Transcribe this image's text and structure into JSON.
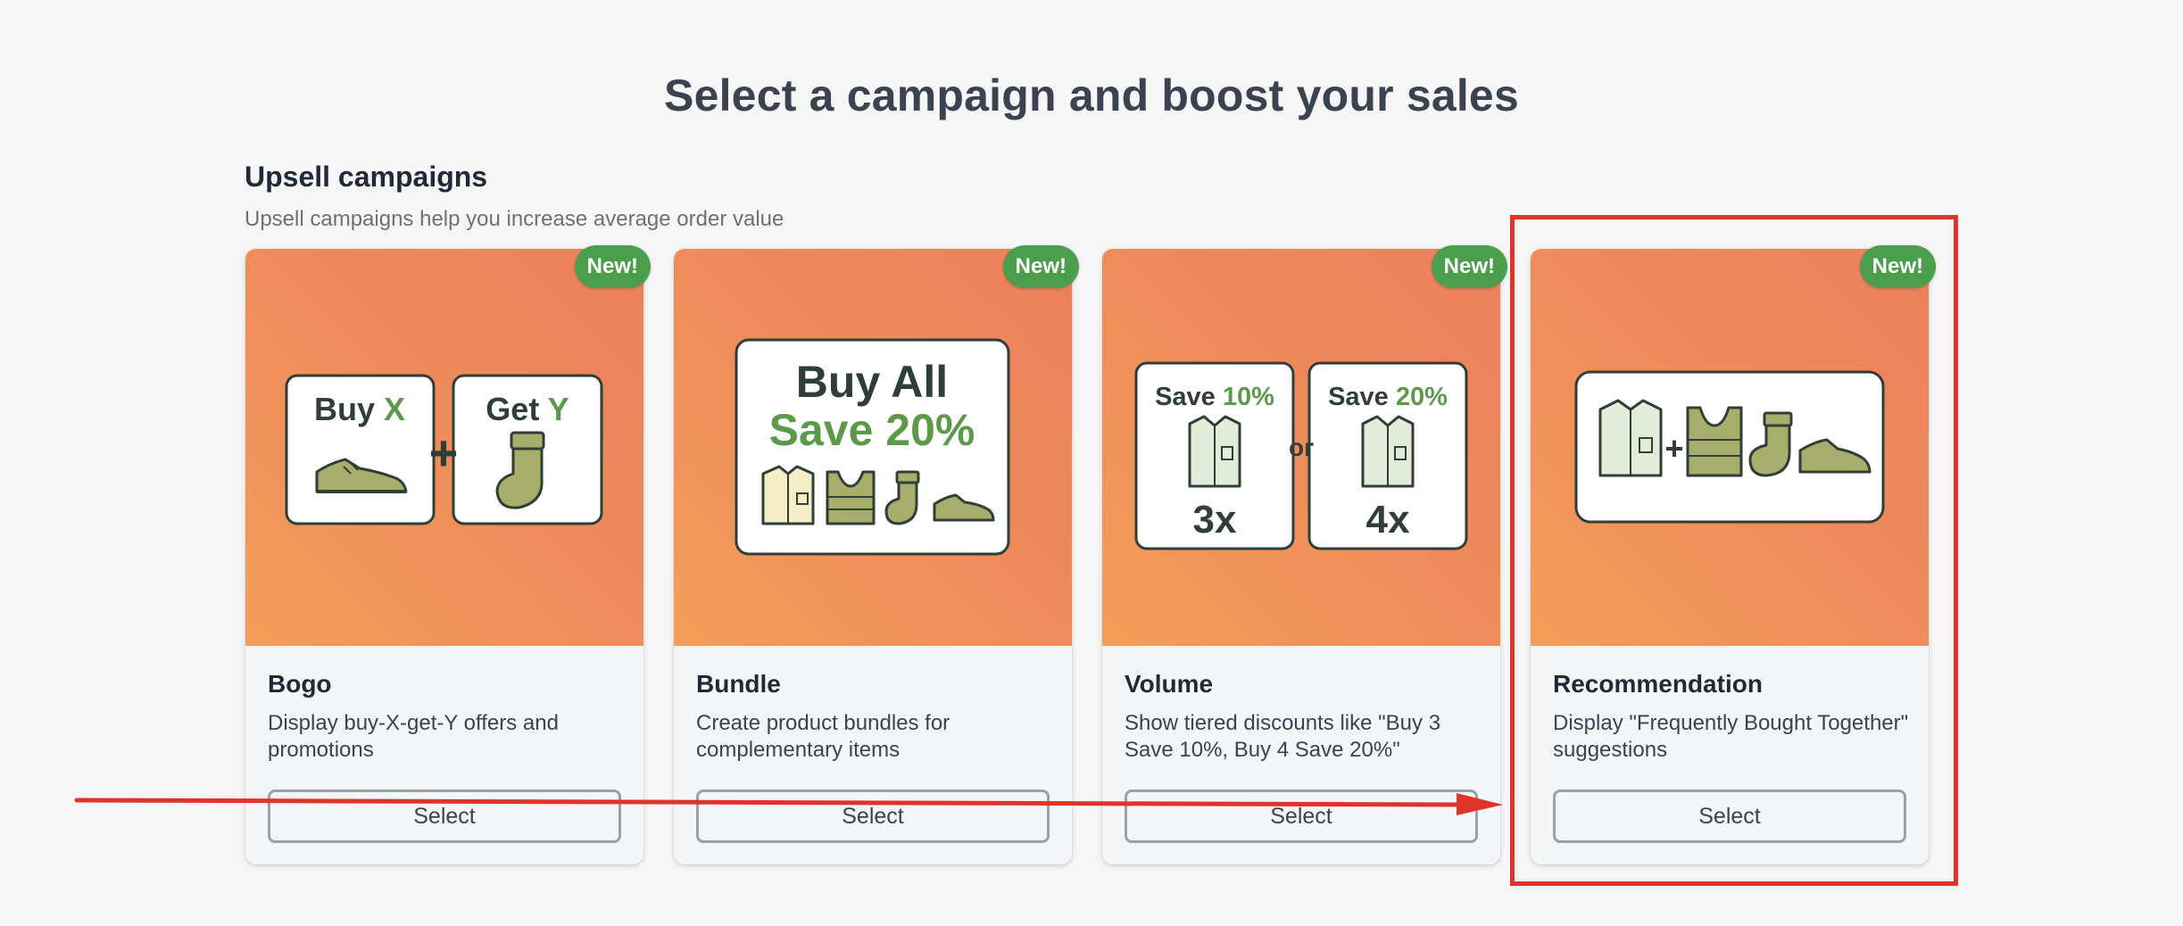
{
  "page": {
    "title": "Select a campaign and boost your sales"
  },
  "section": {
    "title": "Upsell campaigns",
    "subtitle": "Upsell campaigns help you increase average order value"
  },
  "cards": [
    {
      "badge": "New!",
      "name": "Bogo",
      "description": "Display buy-X-get-Y offers and promotions",
      "select_label": "Select",
      "illustration": {
        "left_word": "Buy",
        "left_letter": "X",
        "right_word": "Get",
        "right_letter": "Y",
        "plus": "+"
      }
    },
    {
      "badge": "New!",
      "name": "Bundle",
      "description": "Create product bundles for complementary items",
      "select_label": "Select",
      "illustration": {
        "line1": "Buy All",
        "line2": "Save 20%"
      }
    },
    {
      "badge": "New!",
      "name": "Volume",
      "description": "Show tiered discounts like \"Buy 3 Save 10%, Buy 4 Save 20%\"",
      "select_label": "Select",
      "illustration": {
        "left_word": "Save",
        "left_pct": "10%",
        "left_qty": "3x",
        "or": "or",
        "right_word": "Save",
        "right_pct": "20%",
        "right_qty": "4x"
      }
    },
    {
      "badge": "New!",
      "name": "Recommendation",
      "description": "Display \"Frequently Bought Together\" suggestions",
      "select_label": "Select",
      "illustration": {
        "plus": "+"
      }
    }
  ],
  "colors": {
    "accent_green": "#4a9e4c",
    "annotation_red": "#e0342b",
    "card_gradient_start": "#f29e5a",
    "card_gradient_end": "#ec7f5c"
  }
}
